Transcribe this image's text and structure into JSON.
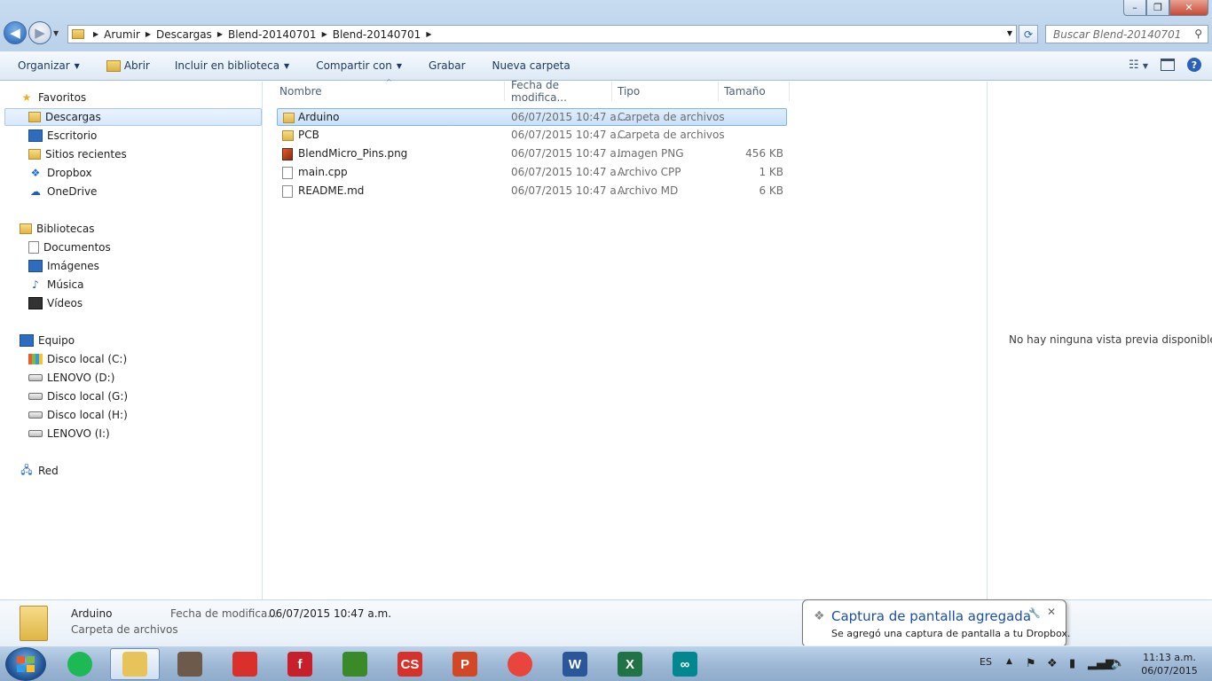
{
  "window": {
    "minimize": "–",
    "maximize": "❐",
    "close": "✕"
  },
  "address": {
    "crumbs": [
      "Arumir",
      "Descargas",
      "Blend-20140701",
      "Blend-20140701"
    ]
  },
  "search": {
    "placeholder": "Buscar Blend-20140701"
  },
  "toolbar": {
    "organize": "Organizar",
    "open": "Abrir",
    "include": "Incluir en biblioteca",
    "share": "Compartir con",
    "burn": "Grabar",
    "new_folder": "Nueva carpeta"
  },
  "sidebar": {
    "favorites": "Favoritos",
    "fav_items": [
      "Descargas",
      "Escritorio",
      "Sitios recientes",
      "Dropbox",
      "OneDrive"
    ],
    "libraries": "Bibliotecas",
    "lib_items": [
      "Documentos",
      "Imágenes",
      "Música",
      "Vídeos"
    ],
    "computer": "Equipo",
    "comp_items": [
      "Disco local (C:)",
      "LENOVO (D:)",
      "Disco local (G:)",
      "Disco local (H:)",
      "LENOVO (I:)"
    ],
    "network": "Red"
  },
  "columns": {
    "name": "Nombre",
    "date": "Fecha de modifica...",
    "type": "Tipo",
    "size": "Tamaño"
  },
  "files": [
    {
      "name": "Arduino",
      "date": "06/07/2015 10:47 a...",
      "type": "Carpeta de archivos",
      "size": "",
      "icon": "folder-icon"
    },
    {
      "name": "PCB",
      "date": "06/07/2015 10:47 a...",
      "type": "Carpeta de archivos",
      "size": "",
      "icon": "folder-icon"
    },
    {
      "name": "BlendMicro_Pins.png",
      "date": "06/07/2015 10:47 a...",
      "type": "Imagen PNG",
      "size": "456 KB",
      "icon": "image-file-icon"
    },
    {
      "name": "main.cpp",
      "date": "06/07/2015 10:47 a...",
      "type": "Archivo CPP",
      "size": "1 KB",
      "icon": "document-icon"
    },
    {
      "name": "README.md",
      "date": "06/07/2015 10:47 a...",
      "type": "Archivo MD",
      "size": "6 KB",
      "icon": "document-icon"
    }
  ],
  "preview": {
    "empty_text": "No hay ninguna vista previa disponible."
  },
  "details": {
    "name": "Arduino",
    "type": "Carpeta de archivos",
    "modified_label": "Fecha de modifica...",
    "modified_value": "06/07/2015 10:47 a.m."
  },
  "notification": {
    "title": "Captura de pantalla agregada",
    "text": "Se agregó una captura de pantalla a tu Dropbox."
  },
  "tray": {
    "language": "ES",
    "time": "11:13 a.m.",
    "date": "06/07/2015"
  },
  "taskbar_apps": [
    {
      "name": "spotify-icon",
      "letter": "",
      "color": "#1db954"
    },
    {
      "name": "explorer-icon",
      "letter": "",
      "color": "#e8c35a"
    },
    {
      "name": "gimp-icon",
      "letter": "",
      "color": "#6d5a4a"
    },
    {
      "name": "sketchup-icon",
      "letter": "",
      "color": "#d9302c"
    },
    {
      "name": "fritzing-icon",
      "letter": "f",
      "color": "#c8202a"
    },
    {
      "name": "pcb-tool-icon",
      "letter": "",
      "color": "#3a8a2a"
    },
    {
      "name": "eagle-icon",
      "letter": "CS",
      "color": "#d6312b"
    },
    {
      "name": "powerpoint-icon",
      "letter": "P",
      "color": "#d24726"
    },
    {
      "name": "chrome-icon",
      "letter": "",
      "color": "#e8453c"
    },
    {
      "name": "word-icon",
      "letter": "W",
      "color": "#2b579a"
    },
    {
      "name": "excel-icon",
      "letter": "X",
      "color": "#217346"
    },
    {
      "name": "arduino-icon",
      "letter": "∞",
      "color": "#00878f"
    }
  ]
}
